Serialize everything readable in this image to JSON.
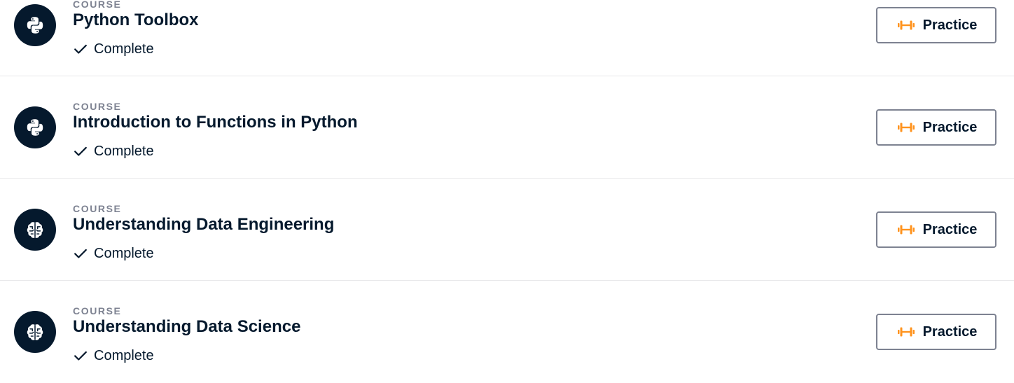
{
  "courses": [
    {
      "type_label": "COURSE",
      "title": "Python Toolbox",
      "status": "Complete",
      "icon": "python-icon",
      "action_label": "Practice",
      "action_icon": "dumbbell-icon"
    },
    {
      "type_label": "COURSE",
      "title": "Introduction to Functions in Python",
      "status": "Complete",
      "icon": "python-icon",
      "action_label": "Practice",
      "action_icon": "dumbbell-icon"
    },
    {
      "type_label": "COURSE",
      "title": "Understanding Data Engineering",
      "status": "Complete",
      "icon": "brain-icon",
      "action_label": "Practice",
      "action_icon": "dumbbell-icon"
    },
    {
      "type_label": "COURSE",
      "title": "Understanding Data Science",
      "status": "Complete",
      "icon": "brain-icon",
      "action_label": "Practice",
      "action_icon": "dumbbell-icon"
    }
  ],
  "colors": {
    "text": "#05192d",
    "muted": "#7d8291",
    "accent": "#ff931e",
    "divider": "#e8e8ea",
    "avatar_bg": "#05192d"
  }
}
